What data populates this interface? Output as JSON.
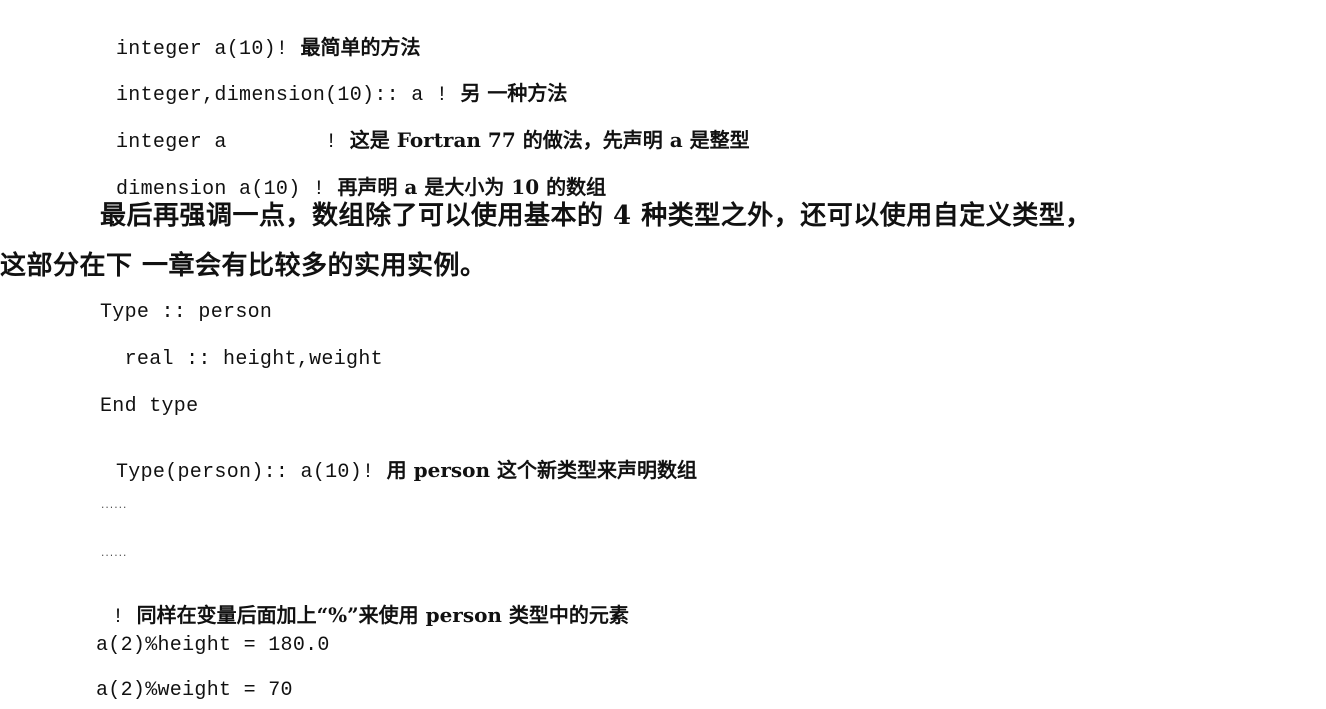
{
  "lines": [
    {
      "code": "integer a(10)! ",
      "comment": "最简单的方法"
    },
    {
      "code": "integer,dimension(10):: a ! ",
      "comment": "另 一种方法"
    },
    {
      "code": "integer a        ! ",
      "comment": "这是 Fortran 77 的做法，先声明 a 是整型"
    },
    {
      "code": "dimension a(10) ! ",
      "comment": "再声明 a 是大小为 10 的数组"
    }
  ],
  "paragraph": {
    "line1": "最后再强调一点，数组除了可以使用基本的 4 种类型之外，还可以使用自定义类型，",
    "line2": "这部分在下 一章会有比较多的实用实例。"
  },
  "type_block": {
    "l1": "Type :: person",
    "l2": "  real :: height,weight",
    "l3": "End type",
    "l4_code": "Type(person):: a(10)! ",
    "l4_comment": "用 person 这个新类型来声明数组",
    "ellipsis1": "......",
    "ellipsis2": "......",
    "l7_code": "! ",
    "l7_comment": "同样在变量后面加上“%”来使用 person 类型中的元素",
    "l8": "a(2)%height = 180.0",
    "l9": "a(2)%weight = 70"
  }
}
